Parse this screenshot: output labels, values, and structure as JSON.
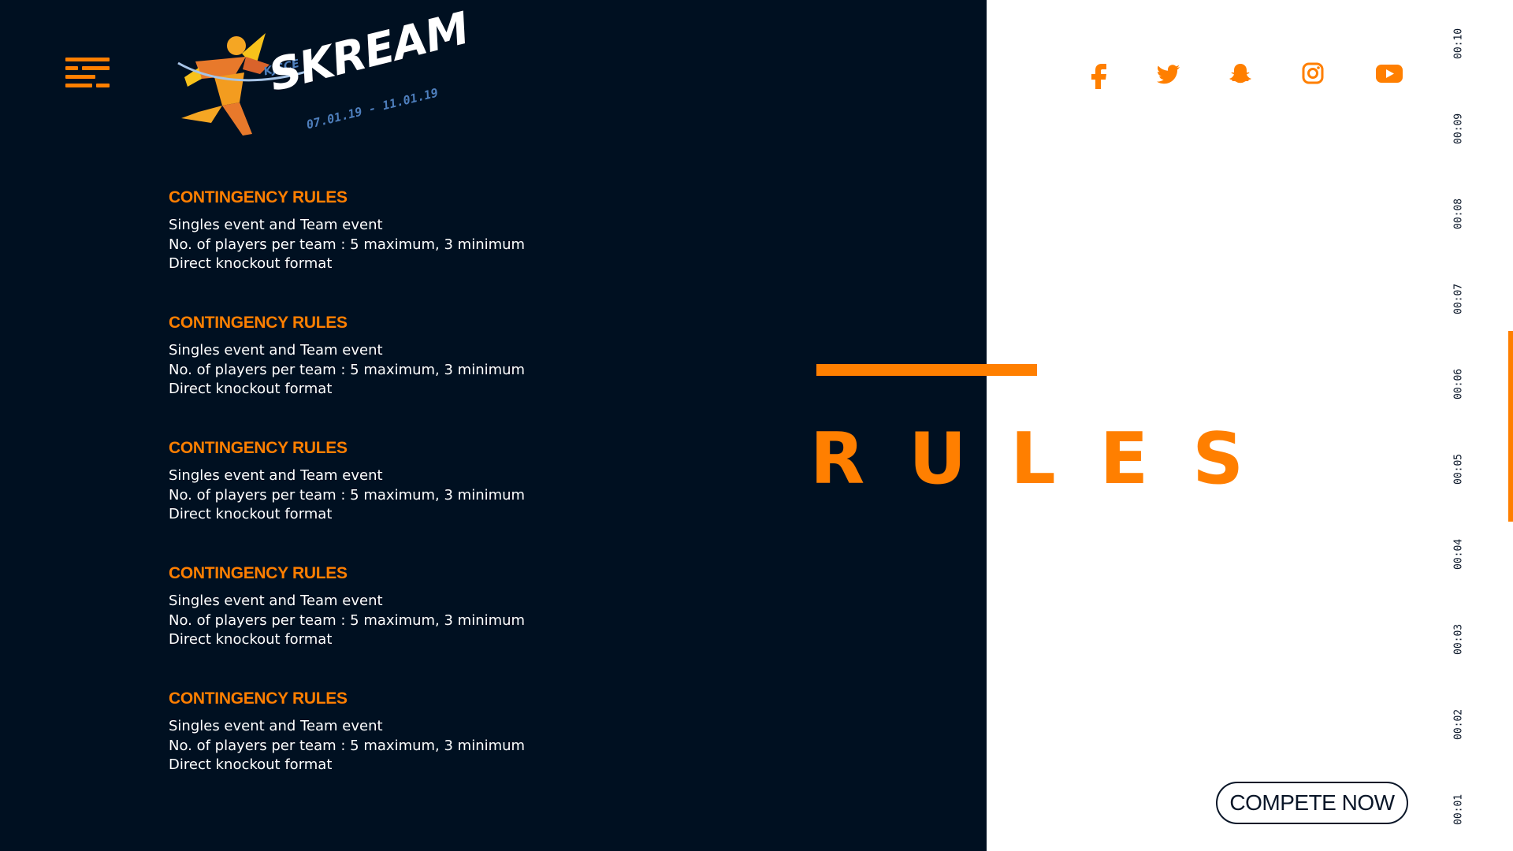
{
  "brand": {
    "kjsce": "KJSCE",
    "name": "SKREAM",
    "dates": "07.01.19 - 11.01.19"
  },
  "rules": [
    {
      "heading": "CONTINGENCY RULES",
      "lines": [
        "Singles event and Team event",
        "No. of players per team : 5 maximum, 3 minimum",
        "Direct knockout format"
      ]
    },
    {
      "heading": "CONTINGENCY RULES",
      "lines": [
        "Singles event and Team event",
        "No. of players per team : 5 maximum, 3 minimum",
        "Direct knockout format"
      ]
    },
    {
      "heading": "CONTINGENCY RULES",
      "lines": [
        "Singles event and Team event",
        "No. of players per team : 5 maximum, 3 minimum",
        "Direct knockout format"
      ]
    },
    {
      "heading": "CONTINGENCY RULES",
      "lines": [
        "Singles event and Team event",
        "No. of players per team : 5 maximum, 3 minimum",
        "Direct knockout format"
      ]
    },
    {
      "heading": "CONTINGENCY RULES",
      "lines": [
        "Singles event and Team event",
        "No. of players per team : 5 maximum, 3 minimum",
        "Direct knockout format"
      ]
    }
  ],
  "section_title": "RULES",
  "social": [
    {
      "name": "facebook-icon"
    },
    {
      "name": "twitter-icon"
    },
    {
      "name": "snapchat-icon"
    },
    {
      "name": "instagram-icon"
    },
    {
      "name": "youtube-icon"
    }
  ],
  "cta": {
    "label": "COMPETE NOW"
  },
  "timeline": [
    "00:10",
    "00:09",
    "00:08",
    "00:07",
    "00:06",
    "00:05",
    "00:04",
    "00:03",
    "00:02",
    "00:01"
  ],
  "timeline_active": "00:06",
  "colors": {
    "accent": "#ff7f00",
    "dark": "#001021",
    "light": "#ffffff",
    "text_dark": "#0a1628"
  }
}
